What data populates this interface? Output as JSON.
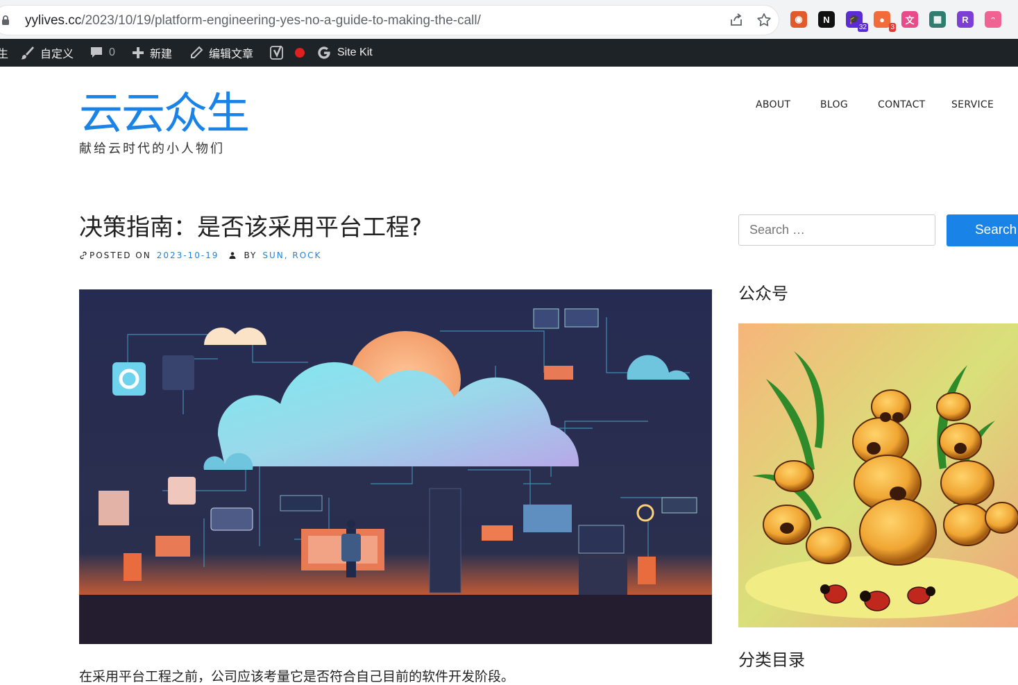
{
  "browser": {
    "url_host": "yylives.cc",
    "url_path": "/2023/10/19/platform-engineering-yes-no-a-guide-to-making-the-call/",
    "extensions": [
      {
        "name": "sync-icon",
        "color": "#e05a2b",
        "glyph": "◉"
      },
      {
        "name": "notion-icon",
        "color": "#111111",
        "glyph": "N"
      },
      {
        "name": "graduation-cap-icon",
        "color": "#5b2bd6",
        "glyph": "🎓",
        "badge": "32",
        "badge_color": "#5b2bd6"
      },
      {
        "name": "bubbles-icon",
        "color": "#f26b3a",
        "glyph": "●",
        "badge": "3",
        "badge_color": "#e53935"
      },
      {
        "name": "translate-icon",
        "color": "#e84a8a",
        "glyph": "文"
      },
      {
        "name": "qr-icon",
        "color": "#2e7d6f",
        "glyph": "▦"
      },
      {
        "name": "r-ext-icon",
        "color": "#7b3fd6",
        "glyph": "R"
      },
      {
        "name": "cat-icon",
        "color": "#f06292",
        "glyph": "ᵔ"
      }
    ]
  },
  "admin_bar": {
    "cut_label": "生",
    "customize": "自定义",
    "comments_count": "0",
    "new": "新建",
    "edit_post": "编辑文章",
    "sitekit": "Site Kit"
  },
  "site": {
    "title": "云云众生",
    "tagline": "献给云时代的小人物们"
  },
  "nav": [
    "ABOUT",
    "BLOG",
    "CONTACT",
    "SERVICE"
  ],
  "post": {
    "title": "决策指南：是否该采用平台工程?",
    "posted_on_label": "POSTED ON",
    "date": "2023-10-19",
    "by_label": "BY",
    "author": "SUN, ROCK",
    "excerpt": "在采用平台工程之前，公司应该考量它是否符合自己目前的软件开发阶段。"
  },
  "sidebar": {
    "search_placeholder": "Search …",
    "search_button": "Search",
    "widget1_title": "公众号",
    "widget2_title": "分类目录"
  },
  "colors": {
    "accent": "#1a83e8",
    "admin_bar_bg": "#1d2327",
    "recording_dot": "#e02020"
  }
}
